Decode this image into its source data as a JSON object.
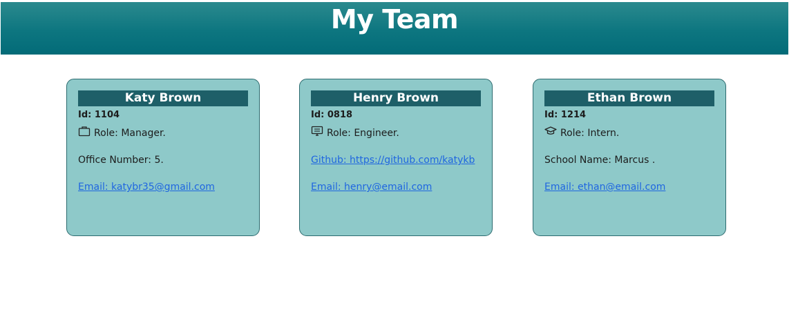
{
  "header": {
    "title": "My Team"
  },
  "cards": [
    {
      "name": "Katy Brown",
      "id": "Id: 1104",
      "role_icon": "briefcase-icon",
      "role": "Role: Manager.",
      "detail": "Office Number: 5.",
      "email": "Email: katybr35@gmail.com"
    },
    {
      "name": "Henry Brown",
      "id": "Id: 0818",
      "role_icon": "monitor-icon",
      "role": "Role: Engineer.",
      "detail": "Github: https://github.com/katykb",
      "email": "Email: henry@email.com"
    },
    {
      "name": "Ethan Brown",
      "id": "Id: 1214",
      "role_icon": "graduation-cap-icon",
      "role": "Role: Intern.",
      "detail": "School Name: Marcus .",
      "email": "Email: ethan@email.com"
    }
  ],
  "colors": {
    "header_top": "#2b8a8e",
    "header_bottom": "#036b78",
    "card_bg": "#8ec9c9",
    "card_title_bg": "#1e5f68",
    "link": "#1f66e0"
  }
}
